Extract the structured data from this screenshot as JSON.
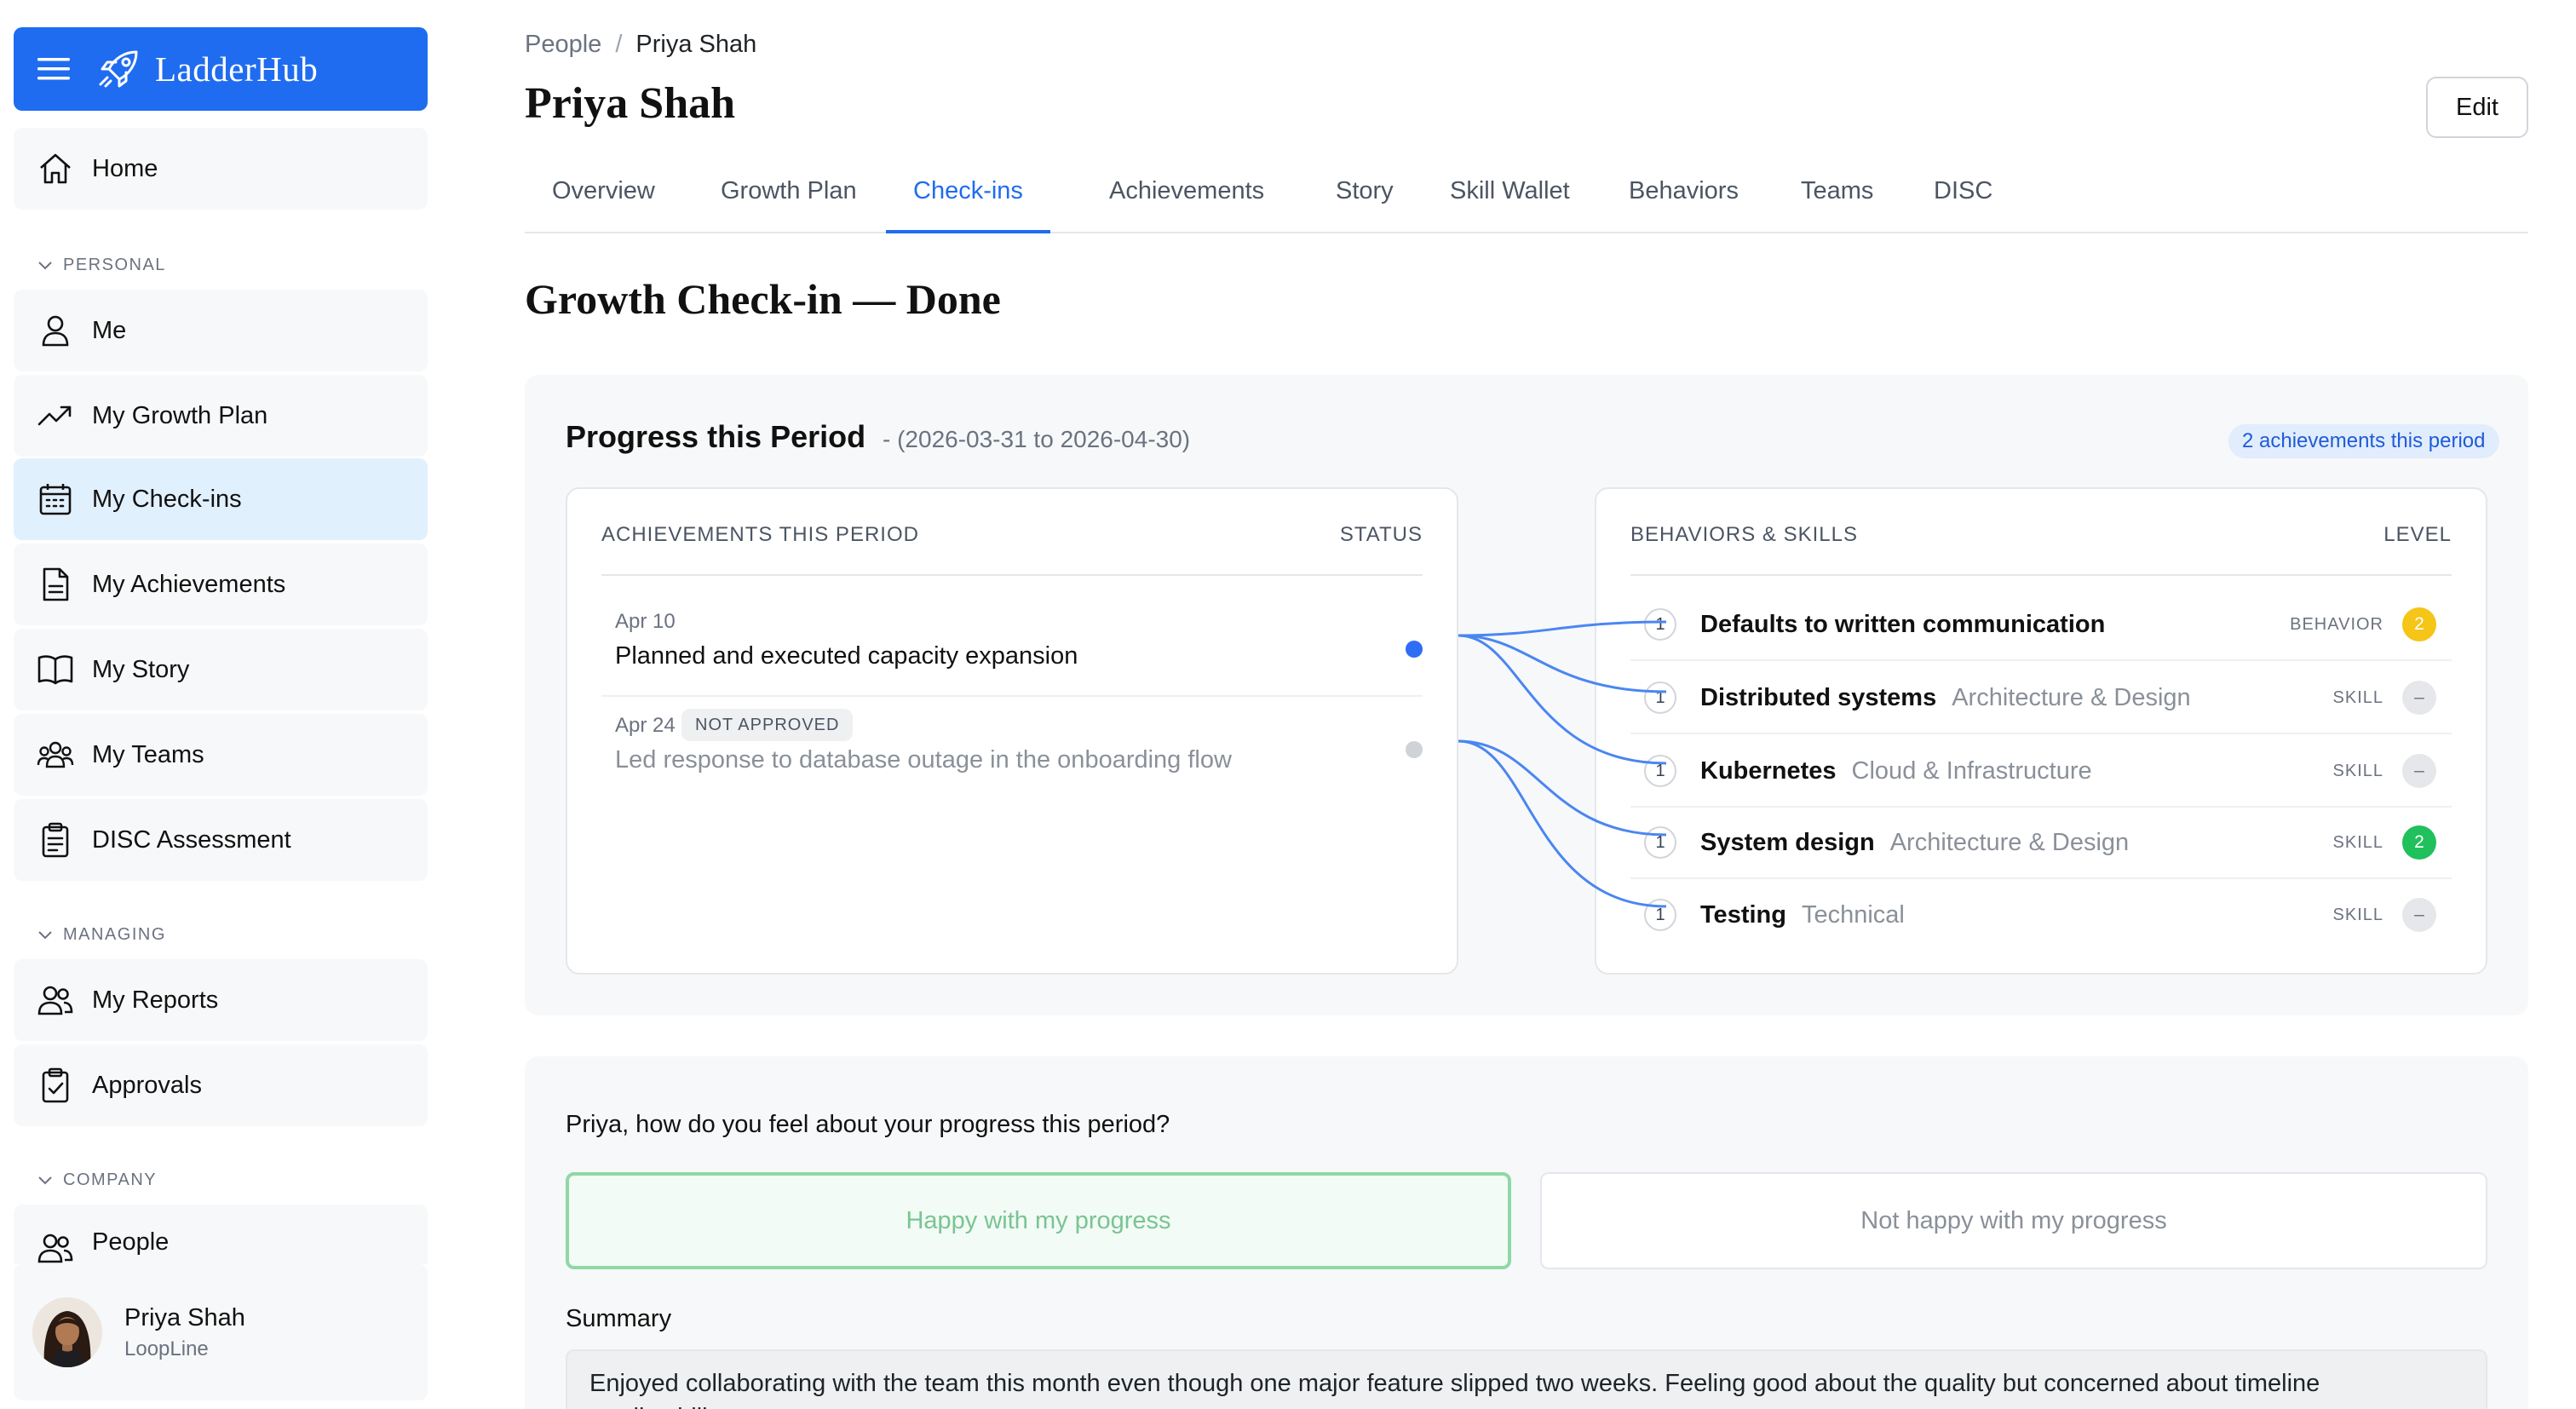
{
  "app": {
    "name": "LadderHub"
  },
  "sidebar": {
    "home": "Home",
    "sections": {
      "personal": "PERSONAL",
      "managing": "MANAGING",
      "company": "COMPANY"
    },
    "personal_items": [
      "Me",
      "My Growth Plan",
      "My Check-ins",
      "My Achievements",
      "My Story",
      "My Teams",
      "DISC Assessment"
    ],
    "managing_items": [
      "My Reports",
      "Approvals"
    ],
    "company_items": [
      "People"
    ],
    "active": "My Check-ins",
    "user": {
      "name": "Priya Shah",
      "org": "LoopLine"
    }
  },
  "header": {
    "breadcrumb": [
      "People",
      "Priya Shah"
    ],
    "breadcrumb_sep": "/",
    "title": "Priya Shah",
    "edit_label": "Edit",
    "tabs": [
      "Overview",
      "Growth Plan",
      "Check-ins",
      "Achievements",
      "Story",
      "Skill Wallet",
      "Behaviors",
      "Teams",
      "DISC"
    ],
    "active_tab": "Check-ins"
  },
  "checkin": {
    "title": "Growth Check-in — Done",
    "progress": {
      "title": "Progress this Period",
      "range": "- (2026-03-31 to 2026-04-30)",
      "badge": "2 achievements this period",
      "achievements_header": "ACHIEVEMENTS THIS PERIOD",
      "status_header": "STATUS",
      "achievements": [
        {
          "date": "Apr 10",
          "title": "Planned and executed capacity expansion",
          "approved": true,
          "status_color": "#2f6df5"
        },
        {
          "date": "Apr 24",
          "badge": "NOT APPROVED",
          "title": "Led response to database outage in the onboarding flow",
          "approved": false,
          "status_color": "#cfd3d8"
        }
      ],
      "skills_header": "BEHAVIORS & SKILLS",
      "level_header": "LEVEL",
      "skills": [
        {
          "count": "1",
          "name": "Defaults to written communication",
          "category": "",
          "type": "BEHAVIOR",
          "level": "2",
          "level_color": "yellow"
        },
        {
          "count": "1",
          "name": "Distributed systems",
          "category": "Architecture & Design",
          "type": "SKILL",
          "level": "–",
          "level_color": "gray"
        },
        {
          "count": "1",
          "name": "Kubernetes",
          "category": "Cloud & Infrastructure",
          "type": "SKILL",
          "level": "–",
          "level_color": "gray"
        },
        {
          "count": "1",
          "name": "System design",
          "category": "Architecture & Design",
          "type": "SKILL",
          "level": "2",
          "level_color": "green"
        },
        {
          "count": "1",
          "name": "Testing",
          "category": "Technical",
          "type": "SKILL",
          "level": "–",
          "level_color": "gray"
        }
      ]
    },
    "feeling": {
      "question": "Priya, how do you feel about your progress this period?",
      "happy": "Happy with my progress",
      "unhappy": "Not happy with my progress",
      "selected": "happy",
      "summary_label": "Summary",
      "summary": "Enjoyed collaborating with the team this month even though one major feature slipped two weeks. Feeling good about the quality but concerned about timeline predictability."
    }
  },
  "colors": {
    "accent": "#1f6cf0",
    "active_nav": "#e1f0fd",
    "link_line": "#4a86f2"
  }
}
